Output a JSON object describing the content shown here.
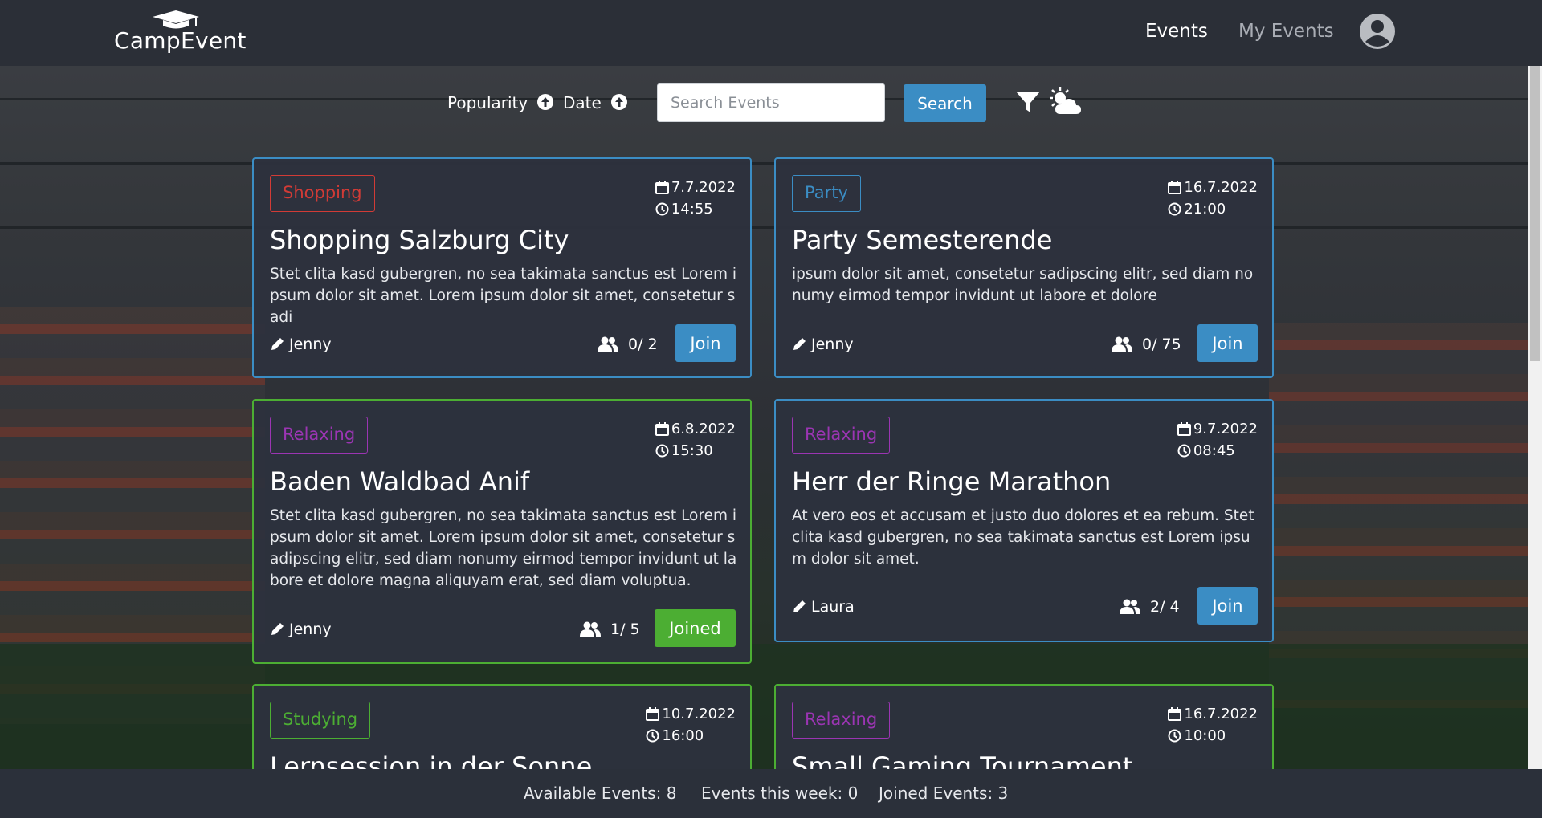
{
  "app": {
    "logo_text": "CampEvent"
  },
  "nav": {
    "events_label": "Events",
    "my_events_label": "My Events"
  },
  "toolbar": {
    "sort_popularity_label": "Popularity",
    "sort_date_label": "Date",
    "search_placeholder": "Search Events",
    "search_value": "",
    "search_button_label": "Search"
  },
  "colors": {
    "primary": "#3b8dc4",
    "joined": "#4cae33",
    "category_shopping": "#d23b36",
    "category_party": "#3b8dc4",
    "category_relaxing": "#9b35b3",
    "category_studying": "#4cae33"
  },
  "events": [
    {
      "category": "Shopping",
      "date": "7.7.2022",
      "time": "14:55",
      "title": "Shopping Salzburg City",
      "description": "Stet clita kasd gubergren, no sea takimata sanctus est Lorem ipsum dolor sit amet. Lorem ipsum dolor sit amet, consetetur sadi",
      "author": "Jenny",
      "participants": "0/ 2",
      "button_label": "Join",
      "joined": false
    },
    {
      "category": "Party",
      "date": "16.7.2022",
      "time": "21:00",
      "title": "Party Semesterende",
      "description": "ipsum dolor sit amet, consetetur sadipscing elitr, sed diam nonumy eirmod tempor invidunt ut labore et dolore",
      "author": "Jenny",
      "participants": "0/ 75",
      "button_label": "Join",
      "joined": false
    },
    {
      "category": "Relaxing",
      "date": "6.8.2022",
      "time": "15:30",
      "title": "Baden Waldbad Anif",
      "description": "Stet clita kasd gubergren, no sea takimata sanctus est Lorem ipsum dolor sit amet. Lorem ipsum dolor sit amet, consetetur sadipscing elitr, sed diam nonumy eirmod tempor invidunt ut labore et dolore magna aliquyam erat, sed diam voluptua.",
      "author": "Jenny",
      "participants": "1/ 5",
      "button_label": "Joined",
      "joined": true
    },
    {
      "category": "Relaxing",
      "date": "9.7.2022",
      "time": "08:45",
      "title": "Herr der Ringe Marathon",
      "description": "At vero eos et accusam et justo duo dolores et ea rebum. Stet clita kasd gubergren, no sea takimata sanctus est Lorem ipsum dolor sit amet.",
      "author": "Laura",
      "participants": "2/ 4",
      "button_label": "Join",
      "joined": false
    },
    {
      "category": "Studying",
      "date": "10.7.2022",
      "time": "16:00",
      "title": "Lernsession in der Sonne"
    },
    {
      "category": "Relaxing",
      "date": "16.7.2022",
      "time": "10:00",
      "title": "Small Gaming Tournament"
    }
  ],
  "footer": {
    "available_events": "Available Events: 8",
    "events_this_week": "Events this week: 0",
    "joined_events": "Joined Events: 3"
  }
}
